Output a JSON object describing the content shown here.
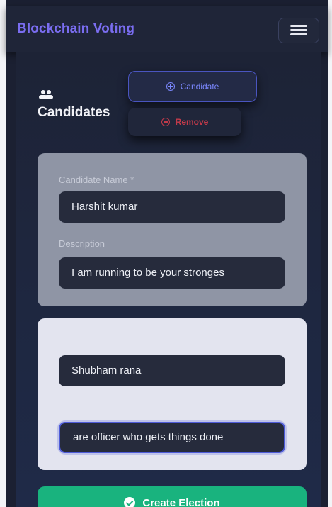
{
  "navbar": {
    "brand": "Blockchain Voting",
    "menu_icon": "hamburger-menu-icon"
  },
  "candidates_section": {
    "title": "Candidates",
    "icon": "users-icon",
    "add_button_label": "Candidate",
    "add_button_icon": "plus-circle-icon",
    "remove_button_label": "Remove",
    "remove_button_icon": "minus-circle-icon"
  },
  "candidates": [
    {
      "name_label": "Candidate Name *",
      "name_value": "Harshit kumar",
      "description_label": "Description",
      "description_value": "I am running to be your stronges"
    },
    {
      "name_value": "Shubham rana",
      "description_value": "are officer who gets things done"
    }
  ],
  "actions": {
    "create_label": "Create Election",
    "create_icon": "check-circle-icon"
  },
  "colors": {
    "background": "#1b2032",
    "brand": "#7a6df0",
    "accent": "#4e5bd8",
    "danger": "#c23a4a",
    "success": "#19b37e"
  }
}
